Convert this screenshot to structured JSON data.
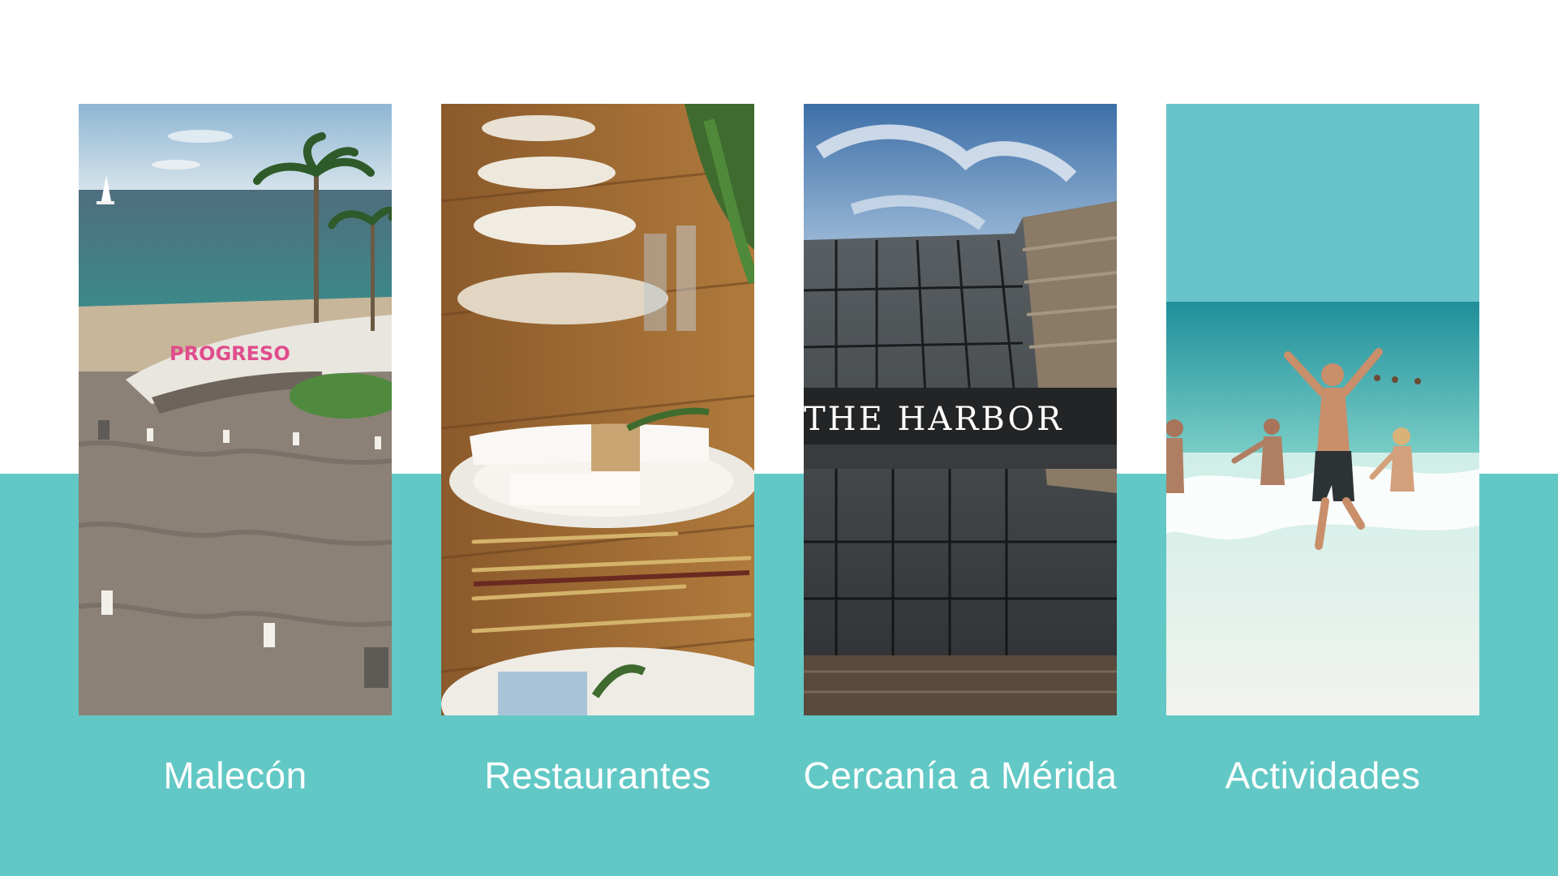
{
  "colors": {
    "background": "#ffffff",
    "band": "#62c8c5",
    "caption_text": "#ffffff"
  },
  "features": [
    {
      "caption": "Malecón",
      "image_text": "PROGRESO"
    },
    {
      "caption": "Restaurantes"
    },
    {
      "caption": "Cercanía a Mérida",
      "image_text": "THE HARBOR"
    },
    {
      "caption": "Actividades"
    }
  ]
}
